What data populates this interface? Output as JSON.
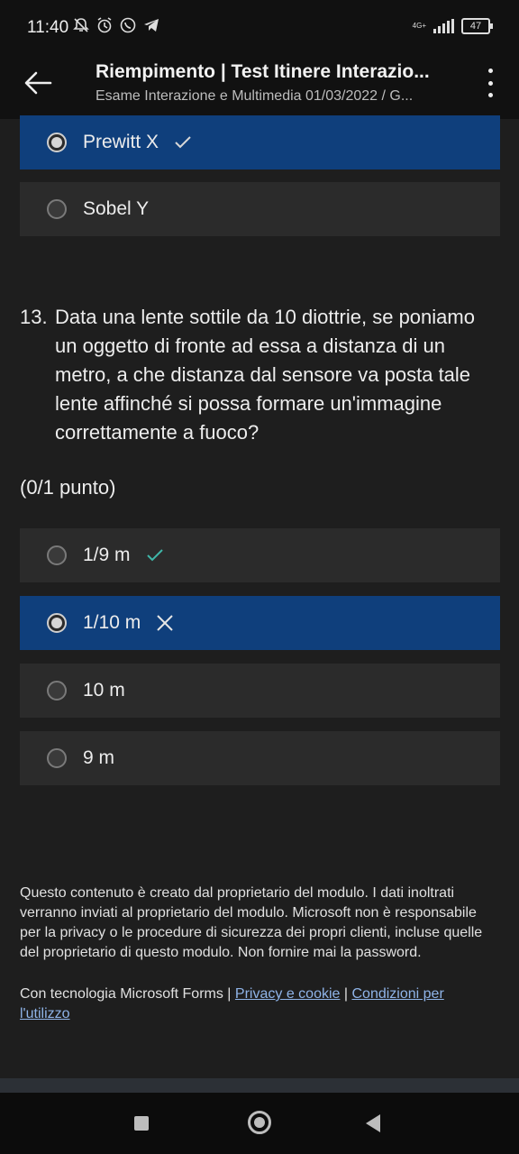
{
  "status": {
    "time": "11:40",
    "network": "4G+",
    "battery": "47"
  },
  "appbar": {
    "title": "Riempimento | Test Itinere Interazio...",
    "subtitle": "Esame Interazione e Multimedia 01/03/2022 / G..."
  },
  "prev_question": {
    "options": [
      {
        "label": "Prewitt X",
        "selected": true,
        "mark": "wrong-check"
      },
      {
        "label": "Sobel Y",
        "selected": false
      }
    ]
  },
  "question13": {
    "number": "13.",
    "text": "Data una lente sottile da 10 diottrie, se poniamo un oggetto di fronte ad essa a distanza di un metro, a che distanza dal sensore va posta tale lente affinché si possa formare un'immagine correttamente a fuoco?",
    "points": "(0/1 punto)",
    "options": [
      {
        "label": "1/9 m",
        "selected": false,
        "mark": "correct-check"
      },
      {
        "label": "1/10 m",
        "selected": true,
        "mark": "cross"
      },
      {
        "label": "10 m",
        "selected": false
      },
      {
        "label": "9 m",
        "selected": false
      }
    ]
  },
  "footer": {
    "disclaimer": "Questo contenuto è creato dal proprietario del modulo. I dati inoltrati verranno inviati al proprietario del modulo. Microsoft non è responsabile per la privacy o le procedure di sicurezza dei propri clienti, incluse quelle del proprietario di questo modulo. Non fornire mai la password.",
    "powered_by": "Con tecnologia Microsoft Forms |",
    "privacy_link": "Privacy e cookie",
    "separator": "|",
    "terms_link": "Condizioni per l'utilizzo"
  },
  "colors": {
    "selected_bg": "#0f3f7c",
    "option_bg": "#2b2b2b",
    "check_green": "#3fb6a8"
  }
}
